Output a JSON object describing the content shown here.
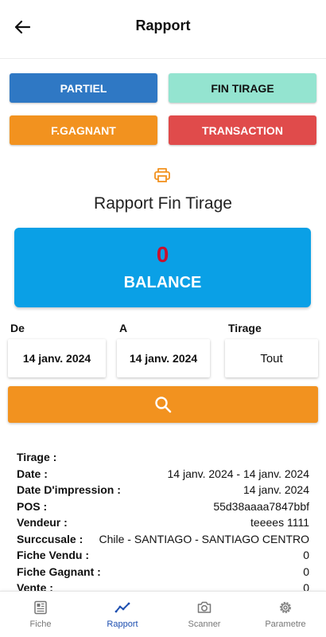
{
  "header": {
    "title": "Rapport",
    "back_icon": "arrow-left-icon"
  },
  "report_buttons": {
    "partiel": "PARTIEL",
    "fin_tirage": "FIN TIRAGE",
    "f_gagnant": "F.GAGNANT",
    "transaction": "TRANSACTION"
  },
  "colors": {
    "partiel": "#2f78c4",
    "fin_tirage": "#94e4d0",
    "f_gagnant": "#f2921f",
    "transaction": "#e04b4b",
    "balance_card": "#0aa0e6",
    "balance_value": "#c8102e",
    "search_button": "#f2921f",
    "nav_active": "#1e4fb0"
  },
  "report_title": "Rapport Fin Tirage",
  "print_icon": "printer-icon",
  "balance": {
    "value": "0",
    "label": "BALANCE"
  },
  "filters": {
    "de_label": "De",
    "de_value": "14 janv. 2024",
    "a_label": "A",
    "a_value": "14 janv. 2024",
    "tirage_label": "Tirage",
    "tirage_value": "Tout"
  },
  "search_icon": "search-icon",
  "details": [
    {
      "key": "Tirage :",
      "value": ""
    },
    {
      "key": "Date :",
      "value": "14 janv. 2024 - 14 janv. 2024"
    },
    {
      "key": "Date D'impression :",
      "value": "14 janv. 2024"
    },
    {
      "key": "POS :",
      "value": "55d38aaaa7847bbf"
    },
    {
      "key": "Vendeur :",
      "value": "teeees 1111"
    },
    {
      "key": "Surccusale :",
      "value": "Chile - SANTIAGO - SANTIAGO CENTRO"
    },
    {
      "key": "Fiche Vendu :",
      "value": "0"
    },
    {
      "key": "Fiche Gagnant :",
      "value": "0"
    },
    {
      "key": "Vente :",
      "value": "0"
    }
  ],
  "nav": {
    "fiche": {
      "label": "Fiche",
      "icon": "newspaper-icon"
    },
    "rapport": {
      "label": "Rapport",
      "icon": "chart-line-icon",
      "active": true
    },
    "scanner": {
      "label": "Scanner",
      "icon": "camera-icon"
    },
    "parametre": {
      "label": "Parametre",
      "icon": "gear-icon"
    }
  }
}
